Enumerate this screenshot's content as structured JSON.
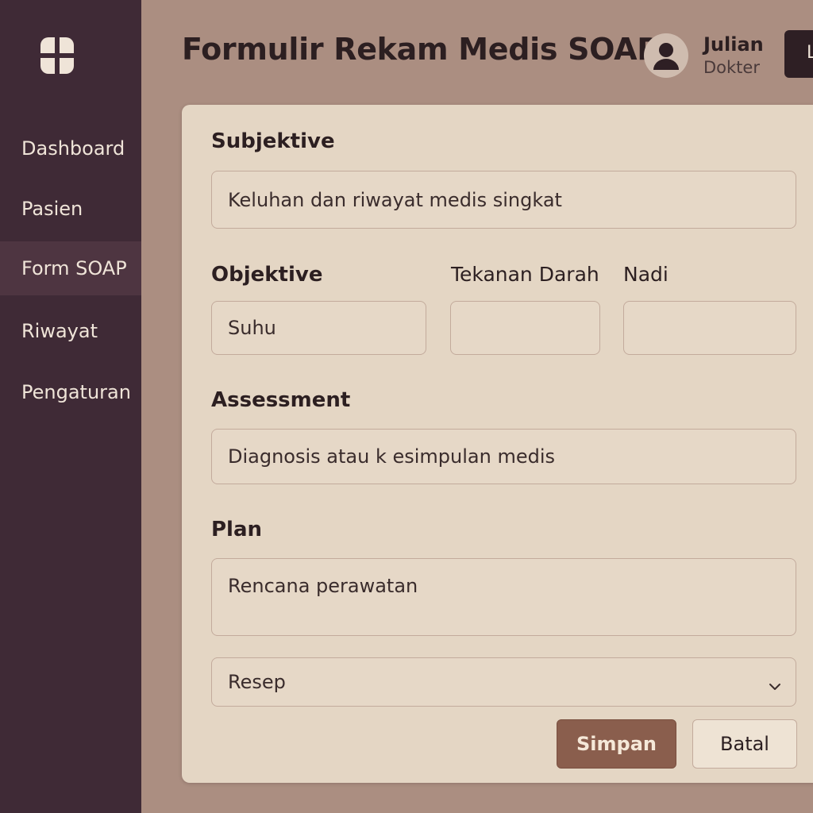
{
  "sidebar": {
    "logo": "medical-cross-icon",
    "items": [
      {
        "label": "Dashboard",
        "active": false
      },
      {
        "label": "Pasien",
        "active": false
      },
      {
        "label": "Form SOAP",
        "active": true
      },
      {
        "label": "Riwayat",
        "active": false
      },
      {
        "label": "Pengaturan",
        "active": false
      }
    ]
  },
  "header": {
    "title": "Formulir Rekam Medis SOAP",
    "user": {
      "name": "Julian",
      "role": "Dokter",
      "avatar_icon": "user-avatar-icon"
    },
    "logout_label": "L"
  },
  "form": {
    "subjective": {
      "label": "Subjektive",
      "placeholder": "Keluhan dan riwayat medis singkat"
    },
    "objective": {
      "label": "Objektive",
      "suhu_placeholder": "Suhu",
      "tekanan_label": "Tekanan Darah",
      "tekanan_value": "",
      "nadi_label": "Nadi",
      "nadi_value": ""
    },
    "assessment": {
      "label": "Assessment",
      "placeholder": "Diagnosis atau k esimpulan medis"
    },
    "plan": {
      "label": "Plan",
      "placeholder": "Rencana perawatan",
      "resep_selected": "Resep"
    },
    "buttons": {
      "save": "Simpan",
      "cancel": "Batal"
    }
  },
  "colors": {
    "background": "#ab8e81",
    "sidebar": "#3f2a36",
    "card": "#e4d6c4",
    "primary_button": "#8a5e4d"
  }
}
